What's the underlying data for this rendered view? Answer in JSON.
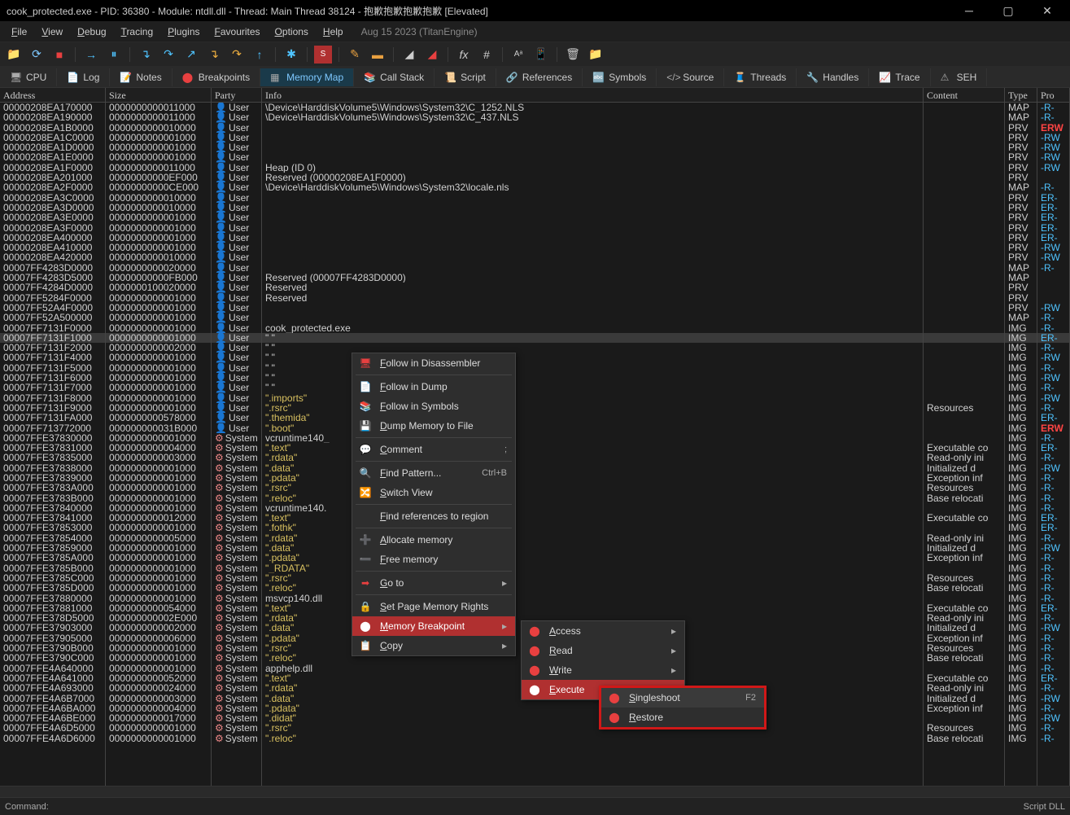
{
  "title": "cook_protected.exe - PID: 36380 - Module: ntdll.dll - Thread: Main Thread 38124 - 抱歉抱歉抱歉抱歉 [Elevated]",
  "menu": [
    "File",
    "View",
    "Debug",
    "Tracing",
    "Plugins",
    "Favourites",
    "Options",
    "Help"
  ],
  "menudate": "Aug 15 2023 (TitanEngine)",
  "tabs": [
    "CPU",
    "Log",
    "Notes",
    "Breakpoints",
    "Memory Map",
    "Call Stack",
    "Script",
    "References",
    "Symbols",
    "Source",
    "Threads",
    "Handles",
    "Trace",
    "SEH"
  ],
  "active_tab": "Memory Map",
  "headers": {
    "addr": "Address",
    "size": "Size",
    "party": "Party",
    "info": "Info",
    "content": "Content",
    "type": "Type",
    "protect": "Pro"
  },
  "status": {
    "left": "Command:",
    "right": "Script DLL"
  },
  "rows": [
    {
      "addr": "00000208EA170000",
      "size": "0000000000011000",
      "party": "User",
      "info": "\\Device\\HarddiskVolume5\\Windows\\System32\\C_1252.NLS",
      "content": "",
      "type": "MAP",
      "prot": "-R-"
    },
    {
      "addr": "00000208EA190000",
      "size": "0000000000011000",
      "party": "User",
      "info": "\\Device\\HarddiskVolume5\\Windows\\System32\\C_437.NLS",
      "content": "",
      "type": "MAP",
      "prot": "-R-"
    },
    {
      "addr": "00000208EA1B0000",
      "size": "0000000000010000",
      "party": "User",
      "info": "",
      "content": "",
      "type": "PRV",
      "prot": "ERW"
    },
    {
      "addr": "00000208EA1C0000",
      "size": "0000000000001000",
      "party": "User",
      "info": "",
      "content": "",
      "type": "PRV",
      "prot": "-RW"
    },
    {
      "addr": "00000208EA1D0000",
      "size": "0000000000001000",
      "party": "User",
      "info": "",
      "content": "",
      "type": "PRV",
      "prot": "-RW"
    },
    {
      "addr": "00000208EA1E0000",
      "size": "0000000000001000",
      "party": "User",
      "info": "",
      "content": "",
      "type": "PRV",
      "prot": "-RW"
    },
    {
      "addr": "00000208EA1F0000",
      "size": "0000000000011000",
      "party": "User",
      "info": "Heap (ID 0)",
      "content": "",
      "type": "PRV",
      "prot": "-RW"
    },
    {
      "addr": "00000208EA201000",
      "size": "00000000000EF000",
      "party": "User",
      "info": "Reserved (00000208EA1F0000)",
      "content": "",
      "type": "PRV",
      "prot": ""
    },
    {
      "addr": "00000208EA2F0000",
      "size": "00000000000CE000",
      "party": "User",
      "info": "\\Device\\HarddiskVolume5\\Windows\\System32\\locale.nls",
      "content": "",
      "type": "MAP",
      "prot": "-R-"
    },
    {
      "addr": "00000208EA3C0000",
      "size": "0000000000010000",
      "party": "User",
      "info": "",
      "content": "",
      "type": "PRV",
      "prot": "ER-"
    },
    {
      "addr": "00000208EA3D0000",
      "size": "0000000000010000",
      "party": "User",
      "info": "",
      "content": "",
      "type": "PRV",
      "prot": "ER-"
    },
    {
      "addr": "00000208EA3E0000",
      "size": "0000000000001000",
      "party": "User",
      "info": "",
      "content": "",
      "type": "PRV",
      "prot": "ER-"
    },
    {
      "addr": "00000208EA3F0000",
      "size": "0000000000001000",
      "party": "User",
      "info": "",
      "content": "",
      "type": "PRV",
      "prot": "ER-"
    },
    {
      "addr": "00000208EA400000",
      "size": "0000000000001000",
      "party": "User",
      "info": "",
      "content": "",
      "type": "PRV",
      "prot": "ER-"
    },
    {
      "addr": "00000208EA410000",
      "size": "0000000000001000",
      "party": "User",
      "info": "",
      "content": "",
      "type": "PRV",
      "prot": "-RW"
    },
    {
      "addr": "00000208EA420000",
      "size": "0000000000010000",
      "party": "User",
      "info": "",
      "content": "",
      "type": "PRV",
      "prot": "-RW"
    },
    {
      "addr": "00007FF4283D0000",
      "size": "0000000000020000",
      "party": "User",
      "info": "",
      "content": "",
      "type": "MAP",
      "prot": "-R-"
    },
    {
      "addr": "00007FF4283D5000",
      "size": "00000000000FB000",
      "party": "User",
      "info": "Reserved (00007FF4283D0000)",
      "content": "",
      "type": "MAP",
      "prot": ""
    },
    {
      "addr": "00007FF4284D0000",
      "size": "0000000100020000",
      "party": "User",
      "info": "Reserved",
      "content": "",
      "type": "PRV",
      "prot": ""
    },
    {
      "addr": "00007FF5284F0000",
      "size": "0000000000001000",
      "party": "User",
      "info": "Reserved",
      "content": "",
      "type": "PRV",
      "prot": ""
    },
    {
      "addr": "00007FF52A4F0000",
      "size": "0000000000001000",
      "party": "User",
      "info": "",
      "content": "",
      "type": "PRV",
      "prot": "-RW"
    },
    {
      "addr": "00007FF52A500000",
      "size": "0000000000001000",
      "party": "User",
      "info": "",
      "content": "",
      "type": "MAP",
      "prot": "-R-"
    },
    {
      "addr": "00007FF7131F0000",
      "size": "0000000000001000",
      "party": "User",
      "info": "cook_protected.exe",
      "content": "",
      "type": "IMG",
      "prot": "-R-"
    },
    {
      "addr": "00007FF7131F1000",
      "size": "0000000000001000",
      "party": "User",
      "info": "\"      \"",
      "content": "",
      "type": "IMG",
      "prot": "ER-",
      "sel": true
    },
    {
      "addr": "00007FF7131F2000",
      "size": "0000000000002000",
      "party": "User",
      "info": "\"      \"",
      "content": "",
      "type": "IMG",
      "prot": "-R-"
    },
    {
      "addr": "00007FF7131F4000",
      "size": "0000000000001000",
      "party": "User",
      "info": "\"      \"",
      "content": "",
      "type": "IMG",
      "prot": "-RW"
    },
    {
      "addr": "00007FF7131F5000",
      "size": "0000000000001000",
      "party": "User",
      "info": "\"      \"",
      "content": "",
      "type": "IMG",
      "prot": "-R-"
    },
    {
      "addr": "00007FF7131F6000",
      "size": "0000000000001000",
      "party": "User",
      "info": "\"      \"",
      "content": "",
      "type": "IMG",
      "prot": "-RW"
    },
    {
      "addr": "00007FF7131F7000",
      "size": "0000000000001000",
      "party": "User",
      "info": "\"      \"",
      "content": "",
      "type": "IMG",
      "prot": "-R-"
    },
    {
      "addr": "00007FF7131F8000",
      "size": "0000000000001000",
      "party": "User",
      "info": "\".imports\"",
      "content": "",
      "type": "IMG",
      "prot": "-RW",
      "sect": true
    },
    {
      "addr": "00007FF7131F9000",
      "size": "0000000000001000",
      "party": "User",
      "info": "\".rsrc\"",
      "content": "Resources",
      "type": "IMG",
      "prot": "-R-",
      "sect": true
    },
    {
      "addr": "00007FF7131FA000",
      "size": "0000000000578000",
      "party": "User",
      "info": "\".themida\"",
      "content": "",
      "type": "IMG",
      "prot": "ER-",
      "sect": true
    },
    {
      "addr": "00007FF713772000",
      "size": "000000000031B000",
      "party": "User",
      "info": "\".boot\"",
      "content": "",
      "type": "IMG",
      "prot": "ERW",
      "sect": true
    },
    {
      "addr": "00007FFE37830000",
      "size": "0000000000001000",
      "party": "System",
      "info": "vcruntime140_",
      "content": "",
      "type": "IMG",
      "prot": "-R-"
    },
    {
      "addr": "00007FFE37831000",
      "size": "0000000000004000",
      "party": "System",
      "info": "\".text\"",
      "content": "Executable co",
      "type": "IMG",
      "prot": "ER-",
      "sect": true
    },
    {
      "addr": "00007FFE37835000",
      "size": "0000000000003000",
      "party": "System",
      "info": "\".rdata\"",
      "content": "Read-only ini",
      "type": "IMG",
      "prot": "-R-",
      "sect": true
    },
    {
      "addr": "00007FFE37838000",
      "size": "0000000000001000",
      "party": "System",
      "info": "\".data\"",
      "content": "Initialized d",
      "type": "IMG",
      "prot": "-RW",
      "sect": true
    },
    {
      "addr": "00007FFE37839000",
      "size": "0000000000001000",
      "party": "System",
      "info": "\".pdata\"",
      "content": "Exception inf",
      "type": "IMG",
      "prot": "-R-",
      "sect": true
    },
    {
      "addr": "00007FFE3783A000",
      "size": "0000000000001000",
      "party": "System",
      "info": "\".rsrc\"",
      "content": "Resources",
      "type": "IMG",
      "prot": "-R-",
      "sect": true
    },
    {
      "addr": "00007FFE3783B000",
      "size": "0000000000001000",
      "party": "System",
      "info": "\".reloc\"",
      "content": "Base relocati",
      "type": "IMG",
      "prot": "-R-",
      "sect": true
    },
    {
      "addr": "00007FFE37840000",
      "size": "0000000000001000",
      "party": "System",
      "info": "vcruntime140.",
      "content": "",
      "type": "IMG",
      "prot": "-R-"
    },
    {
      "addr": "00007FFE37841000",
      "size": "0000000000012000",
      "party": "System",
      "info": "\".text\"",
      "content": "Executable co",
      "type": "IMG",
      "prot": "ER-",
      "sect": true
    },
    {
      "addr": "00007FFE37853000",
      "size": "0000000000001000",
      "party": "System",
      "info": "\".fothk\"",
      "content": "",
      "type": "IMG",
      "prot": "ER-",
      "sect": true
    },
    {
      "addr": "00007FFE37854000",
      "size": "0000000000005000",
      "party": "System",
      "info": "\".rdata\"",
      "content": "Read-only ini",
      "type": "IMG",
      "prot": "-R-",
      "sect": true
    },
    {
      "addr": "00007FFE37859000",
      "size": "0000000000001000",
      "party": "System",
      "info": "\".data\"",
      "content": "Initialized d",
      "type": "IMG",
      "prot": "-RW",
      "sect": true
    },
    {
      "addr": "00007FFE3785A000",
      "size": "0000000000001000",
      "party": "System",
      "info": "\".pdata\"",
      "content": "Exception inf",
      "type": "IMG",
      "prot": "-R-",
      "sect": true
    },
    {
      "addr": "00007FFE3785B000",
      "size": "0000000000001000",
      "party": "System",
      "info": "\"_RDATA\"",
      "content": "",
      "type": "IMG",
      "prot": "-R-",
      "sect": true
    },
    {
      "addr": "00007FFE3785C000",
      "size": "0000000000001000",
      "party": "System",
      "info": "\".rsrc\"",
      "content": "Resources",
      "type": "IMG",
      "prot": "-R-",
      "sect": true
    },
    {
      "addr": "00007FFE3785D000",
      "size": "0000000000001000",
      "party": "System",
      "info": "\".reloc\"",
      "content": "Base relocati",
      "type": "IMG",
      "prot": "-R-",
      "sect": true
    },
    {
      "addr": "00007FFE37880000",
      "size": "0000000000001000",
      "party": "System",
      "info": "msvcp140.dll",
      "content": "",
      "type": "IMG",
      "prot": "-R-"
    },
    {
      "addr": "00007FFE37881000",
      "size": "0000000000054000",
      "party": "System",
      "info": "\".text\"",
      "content": "Executable co",
      "type": "IMG",
      "prot": "ER-",
      "sect": true
    },
    {
      "addr": "00007FFE378D5000",
      "size": "000000000002E000",
      "party": "System",
      "info": "\".rdata\"",
      "content": "Read-only ini",
      "type": "IMG",
      "prot": "-R-",
      "sect": true
    },
    {
      "addr": "00007FFE37903000",
      "size": "0000000000002000",
      "party": "System",
      "info": "\".data\"",
      "content": "Initialized d",
      "type": "IMG",
      "prot": "-RW",
      "sect": true
    },
    {
      "addr": "00007FFE37905000",
      "size": "0000000000006000",
      "party": "System",
      "info": "\".pdata\"",
      "content": "Exception inf",
      "type": "IMG",
      "prot": "-R-",
      "sect": true
    },
    {
      "addr": "00007FFE3790B000",
      "size": "0000000000001000",
      "party": "System",
      "info": "\".rsrc\"",
      "content": "Resources",
      "type": "IMG",
      "prot": "-R-",
      "sect": true
    },
    {
      "addr": "00007FFE3790C000",
      "size": "0000000000001000",
      "party": "System",
      "info": "\".reloc\"",
      "content": "Base relocati",
      "type": "IMG",
      "prot": "-R-",
      "sect": true
    },
    {
      "addr": "00007FFE4A640000",
      "size": "0000000000001000",
      "party": "System",
      "info": "apphelp.dll",
      "content": "",
      "type": "IMG",
      "prot": "-R-"
    },
    {
      "addr": "00007FFE4A641000",
      "size": "0000000000052000",
      "party": "System",
      "info": "\".text\"",
      "content": "Executable co",
      "type": "IMG",
      "prot": "ER-",
      "sect": true
    },
    {
      "addr": "00007FFE4A693000",
      "size": "0000000000024000",
      "party": "System",
      "info": "\".rdata\"",
      "content": "Read-only ini",
      "type": "IMG",
      "prot": "-R-",
      "sect": true
    },
    {
      "addr": "00007FFE4A6B7000",
      "size": "0000000000003000",
      "party": "System",
      "info": "\".data\"",
      "content": "Initialized d",
      "type": "IMG",
      "prot": "-RW",
      "sect": true
    },
    {
      "addr": "00007FFE4A6BA000",
      "size": "0000000000004000",
      "party": "System",
      "info": "\".pdata\"",
      "content": "Exception inf",
      "type": "IMG",
      "prot": "-R-",
      "sect": true
    },
    {
      "addr": "00007FFE4A6BE000",
      "size": "0000000000017000",
      "party": "System",
      "info": "\".didat\"",
      "content": "",
      "type": "IMG",
      "prot": "-RW",
      "sect": true
    },
    {
      "addr": "00007FFE4A6D5000",
      "size": "0000000000001000",
      "party": "System",
      "info": "\".rsrc\"",
      "content": "Resources",
      "type": "IMG",
      "prot": "-R-",
      "sect": true
    },
    {
      "addr": "00007FFE4A6D6000",
      "size": "0000000000001000",
      "party": "System",
      "info": "\".reloc\"",
      "content": "Base relocati",
      "type": "IMG",
      "prot": "-R-",
      "sect": true
    }
  ],
  "ctx1": [
    {
      "label": "Follow in Disassembler",
      "icon": "🖥"
    },
    {
      "sep": true
    },
    {
      "label": "Follow in Dump",
      "icon": "📄"
    },
    {
      "label": "Follow in Symbols",
      "icon": "📚"
    },
    {
      "label": "Dump Memory to File",
      "icon": "💾"
    },
    {
      "sep": true
    },
    {
      "label": "Comment",
      "icon": "💬",
      "key": ";"
    },
    {
      "sep": true
    },
    {
      "label": "Find Pattern...",
      "icon": "🔍",
      "key": "Ctrl+B"
    },
    {
      "label": "Switch View",
      "icon": "🔀"
    },
    {
      "sep": true
    },
    {
      "label": "Find references to region",
      "icon": ""
    },
    {
      "sep": true
    },
    {
      "label": "Allocate memory",
      "icon": "➕"
    },
    {
      "label": "Free memory",
      "icon": "➖"
    },
    {
      "sep": true
    },
    {
      "label": "Go to",
      "icon": "➡",
      "arrow": true
    },
    {
      "sep": true
    },
    {
      "label": "Set Page Memory Rights",
      "icon": "🔒"
    },
    {
      "label": "Memory Breakpoint",
      "icon": "⬤",
      "arrow": true,
      "active": true
    },
    {
      "label": "Copy",
      "icon": "📋",
      "arrow": true
    }
  ],
  "ctx2": [
    {
      "label": "Access",
      "icon": "⬤",
      "arrow": true
    },
    {
      "label": "Read",
      "icon": "⬤",
      "arrow": true
    },
    {
      "label": "Write",
      "icon": "⬤",
      "arrow": true
    },
    {
      "label": "Execute",
      "icon": "⬤",
      "arrow": true,
      "active": true
    }
  ],
  "ctx3": [
    {
      "label": "Singleshoot",
      "icon": "⬤",
      "key": "F2",
      "hl": true
    },
    {
      "label": "Restore",
      "icon": "⬤"
    }
  ]
}
